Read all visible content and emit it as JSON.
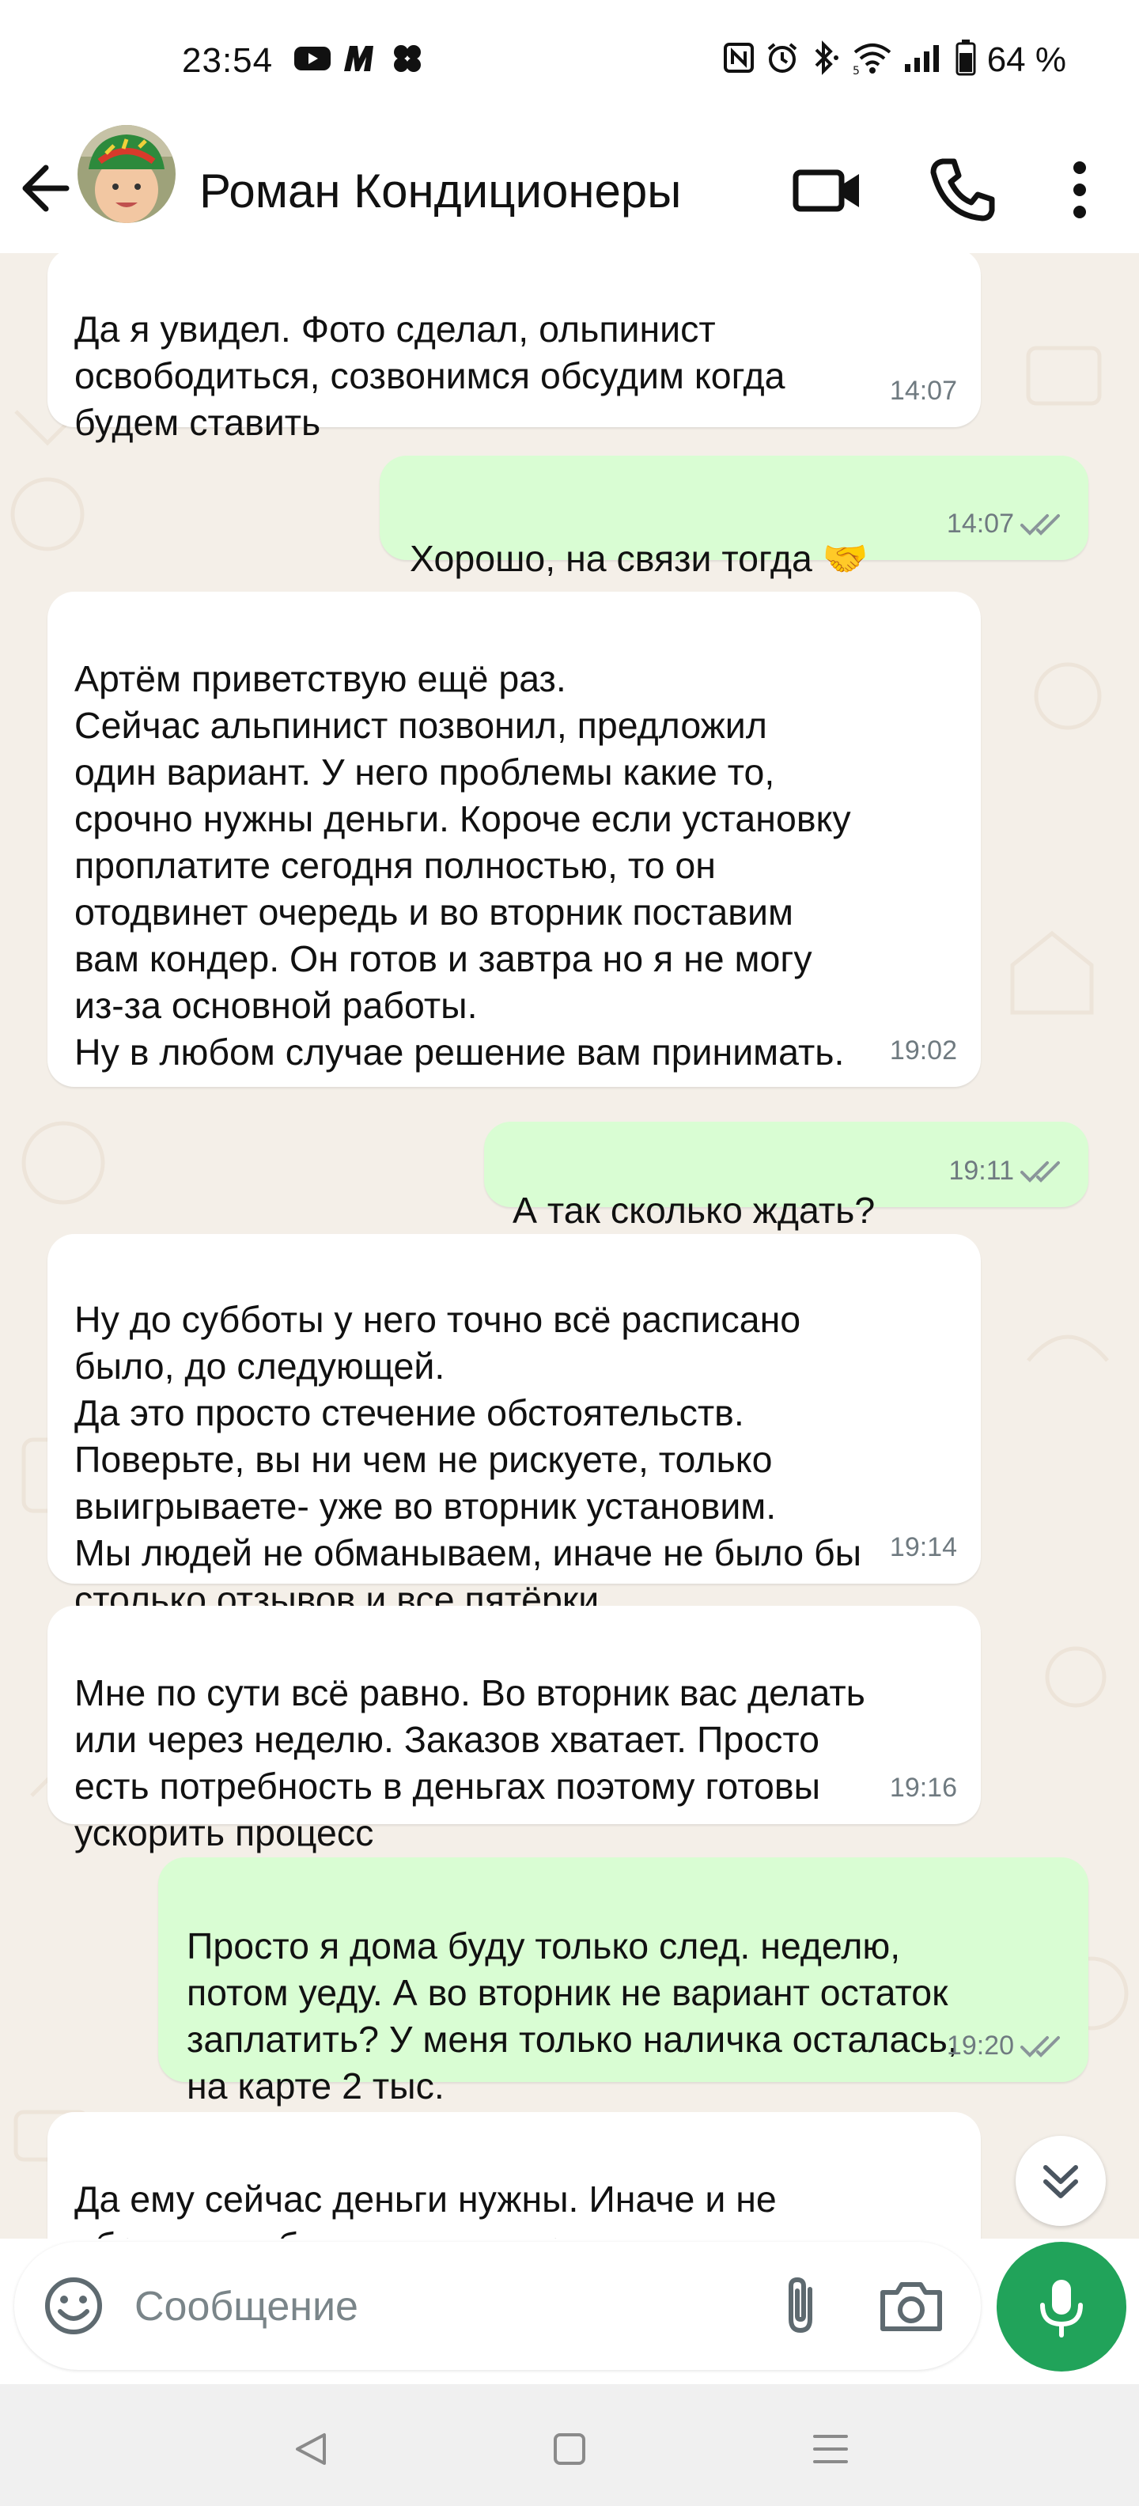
{
  "status_bar": {
    "time": "23:54",
    "left_icons": [
      "youtube-icon",
      "app-m-icon",
      "clover-icon"
    ],
    "right_icons": [
      "nfc-icon",
      "alarm-icon",
      "bluetooth-icon",
      "wifi-icon",
      "signal-icon",
      "battery-icon"
    ],
    "battery_text": "64 %"
  },
  "header": {
    "contact_name": "Роман Кондиционеры",
    "icons": [
      "back-arrow-icon",
      "avatar",
      "video-call-icon",
      "phone-icon",
      "more-vert-icon"
    ]
  },
  "messages": [
    {
      "direction": "in",
      "text": "Да я увидел. Фото сделал, ольпинист\nосвободиться, созвонимся обсудим когда\nбудем ставить",
      "time": "14:07"
    },
    {
      "direction": "out",
      "text": "Хорошо, на связи тогда 🤝",
      "time": "14:07",
      "status": "read"
    },
    {
      "direction": "in",
      "text": "Артём приветствую ещё раз.\nСейчас альпинист позвонил, предложил\nодин вариант. У него проблемы какие то,\nсрочно нужны деньги. Короче если установку\nпроплатите сегодня полностью, то он\nотодвинет очередь и во вторник поставим\nвам кондер. Он готов и завтра но я не могу\nиз-за основной работы.\nНу в любом случае решение вам принимать.",
      "time": "19:02"
    },
    {
      "direction": "out",
      "text": "А так сколько ждать?",
      "time": "19:11",
      "status": "read"
    },
    {
      "direction": "in",
      "text": "Ну до субботы у него точно всё расписано\nбыло, до следующей.\nДа это просто стечение обстоятельств.\nПоверьте, вы ни чем не рискуете, только\nвыигрываете- уже во вторник установим.\nМы людей не обманываем, иначе не было бы\nстолько отзывов и все пятёрки.",
      "time": "19:14"
    },
    {
      "direction": "in",
      "text": "Мне по сути всё равно. Во вторник вас делать\nили через неделю. Заказов хватает. Просто\nесть потребность в деньгах поэтому готовы\nускорить процесс",
      "time": "19:16"
    },
    {
      "direction": "out",
      "text": "Просто я дома буду только след. неделю,\nпотом уеду. А во вторник не вариант остаток\nзаплатить? У меня только наличка осталась,\nна карте 2 тыс.",
      "time": "19:20",
      "status": "read"
    },
    {
      "direction": "in",
      "text": "Да ему сейчас деньги нужны. Иначе и не\nобращался бы он с таким предложением.",
      "time": ""
    }
  ],
  "input": {
    "placeholder": "Сообщение"
  },
  "colors": {
    "outgoing_bubble": "#d9fdd3",
    "incoming_bubble": "#ffffff",
    "chat_background": "#f4efe8",
    "accent_green": "#21a35a",
    "read_ticks": "#8a959a"
  }
}
